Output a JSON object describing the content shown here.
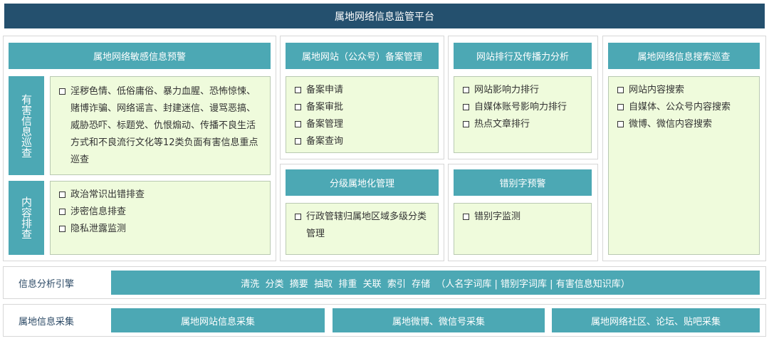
{
  "title": "属地网络信息监管平台",
  "warning": {
    "header": "属地网络敏感信息预警",
    "harmful": {
      "label": "有害信息巡查",
      "text": "淫秽色情、低俗庸俗、暴力血腥、恐怖惊悚、赌博诈骗、网络谣言、封建迷信、谩骂恶搞、威胁恐吓、标题党、仇恨煽动、传播不良生活方式和不良流行文化等12类负面有害信息重点巡查"
    },
    "content": {
      "label": "内容排查",
      "items": [
        "政治常识出错排查",
        "涉密信息排查",
        "隐私泄露监测"
      ]
    }
  },
  "filing": {
    "header": "属地网站（公众号）备案管理",
    "items": [
      "备案申请",
      "备案审批",
      "备案管理",
      "备案查询"
    ]
  },
  "ranking": {
    "header": "网站排行及传播力分析",
    "items": [
      "网站影响力排行",
      "自媒体账号影响力排行",
      "热点文章排行"
    ]
  },
  "search": {
    "header": "属地网络信息搜索巡查",
    "items": [
      "网站内容搜索",
      "自媒体、公众号内容搜索",
      "微博、微信内容搜索"
    ]
  },
  "hierarchy": {
    "header": "分级属地化管理",
    "text": "行政管辖归属地区域多级分类管理"
  },
  "typo": {
    "header": "错别字预警",
    "items": [
      "错别字监测"
    ]
  },
  "engine": {
    "label": "信息分析引擎",
    "text": "清洗  分类  摘要  抽取  排重  关联  索引  存储  （人名字词库 | 错别字词库 | 有害信息知识库）"
  },
  "collection": {
    "label": "属地信息采集",
    "items": [
      "属地网站信息采集",
      "属地微博、微信号采集",
      "属地网络社区、论坛、贴吧采集"
    ]
  }
}
